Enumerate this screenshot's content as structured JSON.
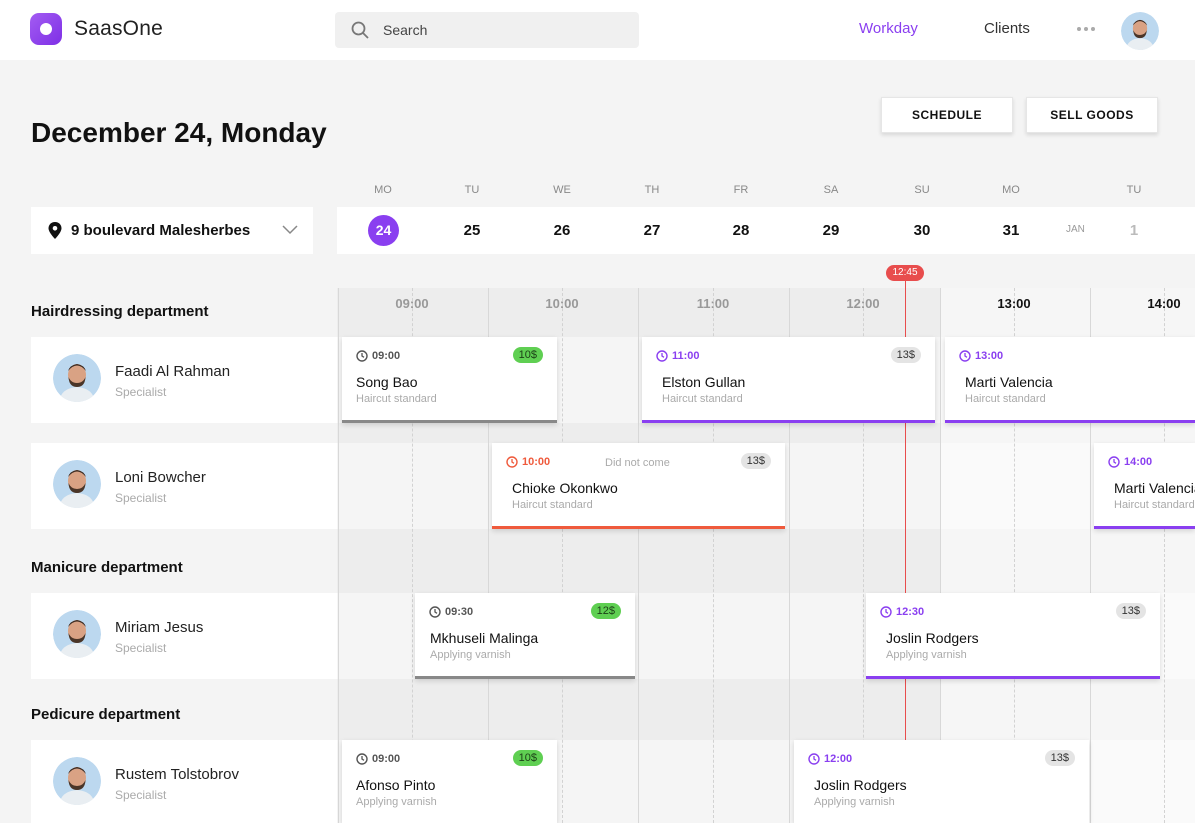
{
  "app": {
    "brand": "SaasOne"
  },
  "search": {
    "placeholder": "Search"
  },
  "nav": {
    "workday": "Workday",
    "clients": "Clients"
  },
  "page": {
    "title": "December 24, Monday"
  },
  "actions": {
    "schedule": "SCHEDULE",
    "sell_goods": "SELL GOODS"
  },
  "location": {
    "label": "9 boulevard Malesherbes"
  },
  "calendar": {
    "weekdays": [
      "MO",
      "TU",
      "WE",
      "TH",
      "FR",
      "SA",
      "SU",
      "MO",
      "TU"
    ],
    "days": [
      "24",
      "25",
      "26",
      "27",
      "28",
      "29",
      "30",
      "31",
      "1"
    ],
    "selected_day": "24",
    "next_month": "JAN"
  },
  "timeline": {
    "hours": [
      "09:00",
      "10:00",
      "11:00",
      "12:00",
      "13:00",
      "14:00"
    ],
    "now": "12:45"
  },
  "departments": {
    "hairdressing": "Hairdressing department",
    "manicure": "Manicure department",
    "pedicure": "Pedicure department"
  },
  "staff": [
    {
      "name": "Faadi Al Rahman",
      "role": "Specialist"
    },
    {
      "name": "Loni Bowcher",
      "role": "Specialist"
    },
    {
      "name": "Miriam Jesus",
      "role": "Specialist"
    },
    {
      "name": "Rustem Tolstobrov",
      "role": "Specialist"
    }
  ],
  "appointments": [
    {
      "time": "09:00",
      "price": "10$",
      "client": "Song Bao",
      "service": "Haircut standard",
      "status": "done"
    },
    {
      "time": "11:00",
      "price": "13$",
      "client": "Elston Gullan",
      "service": "Haircut standard",
      "status": "upcoming"
    },
    {
      "time": "13:00",
      "client": "Marti Valencia",
      "service": "Haircut standard",
      "status": "upcoming"
    },
    {
      "time": "10:00",
      "note": "Did not come",
      "price": "13$",
      "client": "Chioke Okonkwo",
      "service": "Haircut standard",
      "status": "missed"
    },
    {
      "time": "14:00",
      "client": "Marti Valencia",
      "service": "Haircut standard",
      "status": "upcoming"
    },
    {
      "time": "09:30",
      "price": "12$",
      "client": "Mkhuseli Malinga",
      "service": "Applying varnish",
      "status": "done"
    },
    {
      "time": "12:30",
      "price": "13$",
      "client": "Joslin Rodgers",
      "service": "Applying varnish",
      "status": "upcoming"
    },
    {
      "time": "09:00",
      "price": "10$",
      "client": "Afonso Pinto",
      "service": "Applying varnish",
      "status": "done"
    },
    {
      "time": "12:00",
      "price": "13$",
      "client": "Joslin Rodgers",
      "service": "Applying varnish",
      "status": "upcoming"
    }
  ],
  "colors": {
    "accent": "#8a3ff0",
    "missed": "#ef5a3c",
    "paid": "#5fcf52",
    "now": "#e84d4d"
  }
}
